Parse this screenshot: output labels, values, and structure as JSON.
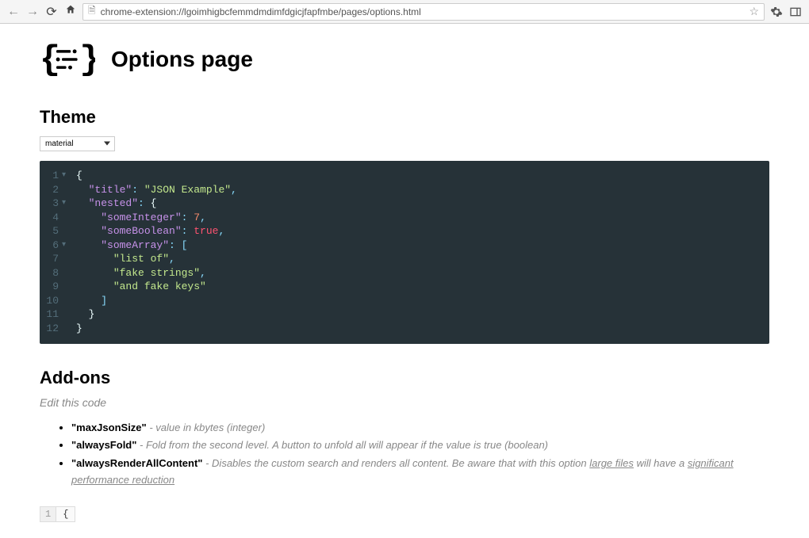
{
  "browser": {
    "url": "chrome-extension://lgoimhigbcfemmdmdimfdgicjfapfmbe/pages/options.html"
  },
  "header": {
    "title": "Options page"
  },
  "theme": {
    "section_title": "Theme",
    "selected": "material"
  },
  "editor": {
    "lines": [
      {
        "n": "1",
        "fold": "▾",
        "indent": 0,
        "tokens": [
          [
            "brace",
            "{"
          ]
        ]
      },
      {
        "n": "2",
        "fold": "",
        "indent": 1,
        "tokens": [
          [
            "key",
            "\"title\""
          ],
          [
            "punct",
            ": "
          ],
          [
            "str",
            "\"JSON Example\""
          ],
          [
            "punct",
            ","
          ]
        ]
      },
      {
        "n": "3",
        "fold": "▾",
        "indent": 1,
        "tokens": [
          [
            "key",
            "\"nested\""
          ],
          [
            "punct",
            ": "
          ],
          [
            "brace",
            "{"
          ]
        ]
      },
      {
        "n": "4",
        "fold": "",
        "indent": 2,
        "tokens": [
          [
            "key",
            "\"someInteger\""
          ],
          [
            "punct",
            ": "
          ],
          [
            "num",
            "7"
          ],
          [
            "punct",
            ","
          ]
        ]
      },
      {
        "n": "5",
        "fold": "",
        "indent": 2,
        "tokens": [
          [
            "key",
            "\"someBoolean\""
          ],
          [
            "punct",
            ": "
          ],
          [
            "bool",
            "true"
          ],
          [
            "punct",
            ","
          ]
        ]
      },
      {
        "n": "6",
        "fold": "▾",
        "indent": 2,
        "tokens": [
          [
            "key",
            "\"someArray\""
          ],
          [
            "punct",
            ": "
          ],
          [
            "punct",
            "["
          ]
        ]
      },
      {
        "n": "7",
        "fold": "",
        "indent": 3,
        "tokens": [
          [
            "str",
            "\"list of\""
          ],
          [
            "punct",
            ","
          ]
        ]
      },
      {
        "n": "8",
        "fold": "",
        "indent": 3,
        "tokens": [
          [
            "str",
            "\"fake strings\""
          ],
          [
            "punct",
            ","
          ]
        ]
      },
      {
        "n": "9",
        "fold": "",
        "indent": 3,
        "tokens": [
          [
            "str",
            "\"and fake keys\""
          ]
        ]
      },
      {
        "n": "10",
        "fold": "",
        "indent": 2,
        "tokens": [
          [
            "punct",
            "]"
          ]
        ]
      },
      {
        "n": "11",
        "fold": "",
        "indent": 1,
        "tokens": [
          [
            "brace",
            "}"
          ]
        ]
      },
      {
        "n": "12",
        "fold": "",
        "indent": 0,
        "tokens": [
          [
            "brace",
            "}"
          ]
        ]
      }
    ]
  },
  "addons": {
    "section_title": "Add-ons",
    "subtitle": "Edit this code",
    "items": [
      {
        "key": "\"maxJsonSize\"",
        "desc": " - value in kbytes (integer)"
      },
      {
        "key": "\"alwaysFold\"",
        "desc": " - Fold from the second level. A button to unfold all will appear if the value is true (boolean)"
      },
      {
        "key": "\"alwaysRenderAllContent\"",
        "desc_pre": " - Disables the custom search and renders all content. Be aware that with this option ",
        "desc_underline": "large files",
        "desc_post": " will have a ",
        "desc_underline2": "significant performance reduction"
      }
    ]
  },
  "mini_editor": {
    "line_num": "1",
    "code": "{"
  }
}
